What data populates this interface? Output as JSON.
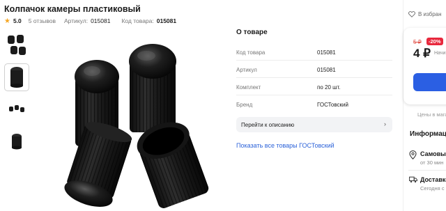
{
  "product": {
    "title": "Колпачок камеры пластиковый",
    "rating": "5.0",
    "reviews": "5 отзывов",
    "article_label": "Артикул:",
    "article_value": "015081",
    "code_label": "Код товара:",
    "code_value": "015081"
  },
  "about": {
    "title": "О товаре",
    "specs": [
      {
        "key": "Код товара",
        "value": "015081"
      },
      {
        "key": "Артикул",
        "value": "015081"
      },
      {
        "key": "Комплект",
        "value": "по 20 шт."
      },
      {
        "key": "Бренд",
        "value": "ГОСТовский"
      }
    ],
    "to_description": "Перейти к описанию",
    "brand_link": "Показать все товары ГОСТовский"
  },
  "sidebar": {
    "favorites": "В избран",
    "old_price": "5 ₽",
    "discount": "-20%",
    "price": "4 ₽",
    "installment": "Начи",
    "price_note": "Цены в мага",
    "info_title": "Информац",
    "delivery": [
      {
        "title": "Самовы",
        "subtitle": "от 30 мин"
      },
      {
        "title": "Доставка",
        "subtitle": "Сегодня с"
      }
    ]
  },
  "colors": {
    "accent_blue": "#2b5fe3",
    "discount_red": "#e8283d",
    "star": "#f5a623"
  },
  "icons": [
    "star-icon",
    "heart-icon",
    "chevron-right-icon",
    "location-pin-icon",
    "truck-icon"
  ]
}
